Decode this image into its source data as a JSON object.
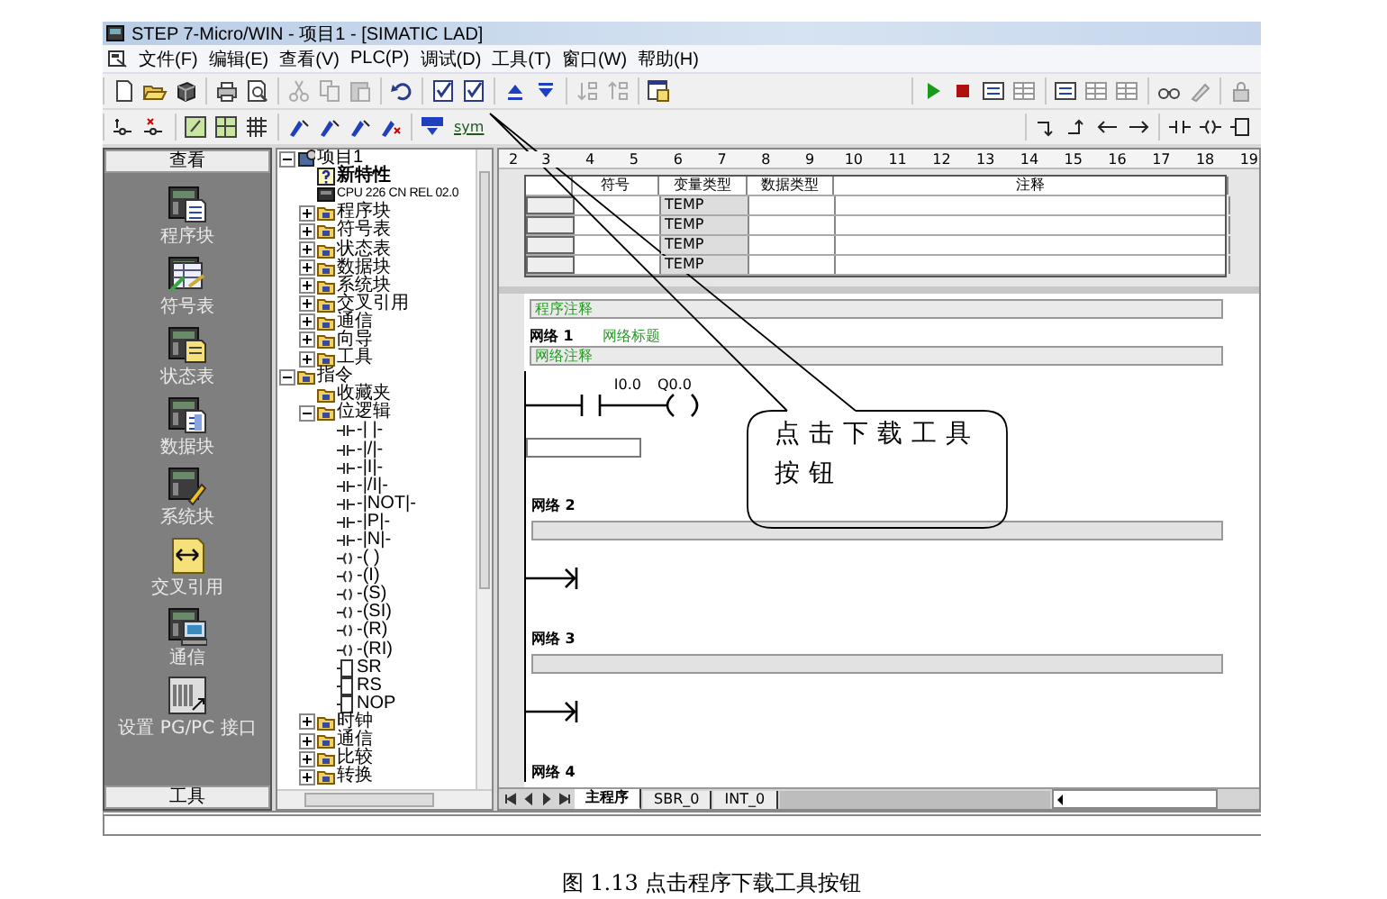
{
  "window": {
    "title": "STEP 7-Micro/WIN - 项目1 - [SIMATIC LAD]"
  },
  "menu": [
    "文件(F)",
    "编辑(E)",
    "查看(V)",
    "PLC(P)",
    "调试(D)",
    "工具(T)",
    "窗口(W)",
    "帮助(H)"
  ],
  "toolbar_2": {
    "symbol_button_text": "sym"
  },
  "navigation_bar": {
    "title": "查看",
    "footer": "工具",
    "items": [
      {
        "label": "程序块",
        "kind": "program"
      },
      {
        "label": "符号表",
        "kind": "symbol"
      },
      {
        "label": "状态表",
        "kind": "status"
      },
      {
        "label": "数据块",
        "kind": "data"
      },
      {
        "label": "系统块",
        "kind": "system"
      },
      {
        "label": "交叉引用",
        "kind": "cross"
      },
      {
        "label": "通信",
        "kind": "comm"
      },
      {
        "label": "设置 PG/PC 接口",
        "kind": "pgpc"
      }
    ]
  },
  "tree": [
    {
      "label": "项目1",
      "kind": "project",
      "expanded": true,
      "children": [
        {
          "label": "新特性",
          "kind": "help"
        },
        {
          "label": "CPU 226 CN REL 02.0",
          "kind": "cpu"
        },
        {
          "label": "程序块",
          "kind": "folder",
          "expanded": false
        },
        {
          "label": "符号表",
          "kind": "folder",
          "expanded": false
        },
        {
          "label": "状态表",
          "kind": "folder",
          "expanded": false
        },
        {
          "label": "数据块",
          "kind": "folder",
          "expanded": false
        },
        {
          "label": "系统块",
          "kind": "folder",
          "expanded": false
        },
        {
          "label": "交叉引用",
          "kind": "folder",
          "expanded": false
        },
        {
          "label": "通信",
          "kind": "folder",
          "expanded": false
        },
        {
          "label": "向导",
          "kind": "folder",
          "expanded": false
        },
        {
          "label": "工具",
          "kind": "folder",
          "expanded": false
        }
      ]
    },
    {
      "label": "指令",
      "kind": "folder",
      "expanded": true,
      "children": [
        {
          "label": "收藏夹",
          "kind": "folder"
        },
        {
          "label": "位逻辑",
          "kind": "folder",
          "expanded": true,
          "children": [
            {
              "label": "-| |-",
              "kind": "contact"
            },
            {
              "label": "-|/|-",
              "kind": "contact"
            },
            {
              "label": "-|I|-",
              "kind": "contact"
            },
            {
              "label": "-|/I|-",
              "kind": "contact"
            },
            {
              "label": "-|NOT|-",
              "kind": "contact"
            },
            {
              "label": "-|P|-",
              "kind": "contact"
            },
            {
              "label": "-|N|-",
              "kind": "contact"
            },
            {
              "label": "-( )",
              "kind": "coil"
            },
            {
              "label": "-(I)",
              "kind": "coil"
            },
            {
              "label": "-(S)",
              "kind": "coil"
            },
            {
              "label": "-(SI)",
              "kind": "coil"
            },
            {
              "label": "-(R)",
              "kind": "coil"
            },
            {
              "label": "-(RI)",
              "kind": "coil"
            },
            {
              "label": "SR",
              "kind": "box"
            },
            {
              "label": "RS",
              "kind": "box"
            },
            {
              "label": "NOP",
              "kind": "box"
            }
          ]
        },
        {
          "label": "时钟",
          "kind": "folder",
          "expanded": false
        },
        {
          "label": "通信",
          "kind": "folder",
          "expanded": false
        },
        {
          "label": "比较",
          "kind": "folder",
          "expanded": false
        },
        {
          "label": "转换",
          "kind": "folder",
          "expanded": false
        }
      ]
    }
  ],
  "ruler": [
    "2",
    "3",
    "4",
    "5",
    "6",
    "7",
    "8",
    "9",
    "10",
    "11",
    "12",
    "13",
    "14",
    "15",
    "16",
    "17",
    "18",
    "19"
  ],
  "var_table": {
    "columns": [
      "符号",
      "变量类型",
      "数据类型",
      "注释"
    ],
    "rows": [
      {
        "var_type": "TEMP"
      },
      {
        "var_type": "TEMP"
      },
      {
        "var_type": "TEMP"
      },
      {
        "var_type": "TEMP"
      }
    ]
  },
  "program_comment": "程序注释",
  "networks": [
    {
      "label": "网络 1",
      "title": "网络标题",
      "comment": "网络注释",
      "kind": "contact_coil",
      "contact": "I0.0",
      "coil": "Q0.0"
    },
    {
      "label": "网络 2",
      "kind": "empty"
    },
    {
      "label": "网络 3",
      "kind": "empty"
    },
    {
      "label": "网络 4",
      "kind": "hidden"
    }
  ],
  "tabs": [
    {
      "label": "主程序",
      "selected": true
    },
    {
      "label": "SBR_0",
      "selected": false
    },
    {
      "label": "INT_0",
      "selected": false
    }
  ],
  "callout": "点击下载工具按钮",
  "caption": "图 1.13  点击程序下载工具按钮"
}
